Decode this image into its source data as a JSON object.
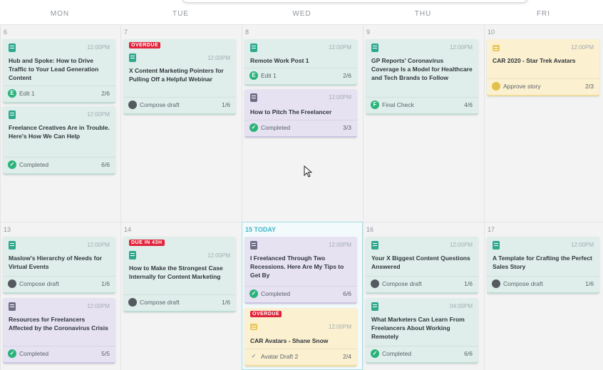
{
  "days": [
    "MON",
    "TUE",
    "WED",
    "THU",
    "FRI"
  ],
  "weeks": [
    {
      "dates": [
        "6",
        "7",
        "8",
        "9",
        "10"
      ]
    },
    {
      "dates": [
        "13",
        "14",
        "15 TODAY",
        "16",
        "17"
      ]
    }
  ],
  "cards": [
    {
      "title": "Hub and Spoke: How to Drive Traffic to Your Lead Generation Content",
      "time": "12:00PM",
      "status": "Edit 1",
      "count": "2/6"
    },
    {
      "title": "Freelance Creatives Are in Trouble. Here's How We Can Help",
      "time": "12:00PM",
      "status": "Completed",
      "count": "6/6"
    },
    {
      "badge": "OVERDUE",
      "title": "X Content Marketing Pointers for Pulling Off a Helpful Webinar",
      "time": "12:00PM",
      "status": "Compose draft",
      "count": "1/6"
    },
    {
      "title": "Remote Work Post 1",
      "time": "12:00PM",
      "status": "Edit 1",
      "count": "2/6"
    },
    {
      "title": "How to Pitch The Freelancer",
      "time": "12:00PM",
      "status": "Completed",
      "count": "3/3"
    },
    {
      "title": "GP Reports' Coronavirus Coverage Is a Model for Healthcare and Tech Brands to Follow",
      "time": "12:00PM",
      "status": "Final Check",
      "count": "4/6"
    },
    {
      "title": "CAR 2020 - Star Trek Avatars",
      "time": "12:00PM",
      "status": "Approve story",
      "count": "2/3"
    },
    {
      "title": "Maslow's Hierarchy of Needs for Virtual Events",
      "time": "12:00PM",
      "status": "Compose draft",
      "count": "1/6"
    },
    {
      "title": "Resources for Freelancers Affected by the Coronavirus Crisis",
      "time": "12:00PM",
      "status": "Completed",
      "count": "5/5"
    },
    {
      "badge": "DUE IN 43H",
      "title": "How to Make the Strongest Case Internally for Content Marketing",
      "time": "12:00PM",
      "status": "Compose draft",
      "count": "1/6"
    },
    {
      "title": "I Freelanced Through Two Recessions. Here Are My Tips to Get By",
      "time": "12:00PM",
      "status": "Completed",
      "count": "6/6"
    },
    {
      "badge": "OVERDUE",
      "title": "CAR Avatars - Shane Snow",
      "time": "12:00PM",
      "status": "Avatar Draft 2",
      "count": "2/4"
    },
    {
      "title": "Your X Biggest Content Questions Answered",
      "time": "12:00PM",
      "status": "Compose draft",
      "count": "1/6"
    },
    {
      "title": "What Marketers Can Learn From Freelancers About Working Remotely",
      "time": "04:00PM",
      "status": "Completed",
      "count": "6/6"
    },
    {
      "title": "A Template for Crafting the Perfect Sales Story",
      "time": "12:00PM",
      "status": "Compose draft",
      "count": "1/6"
    }
  ]
}
